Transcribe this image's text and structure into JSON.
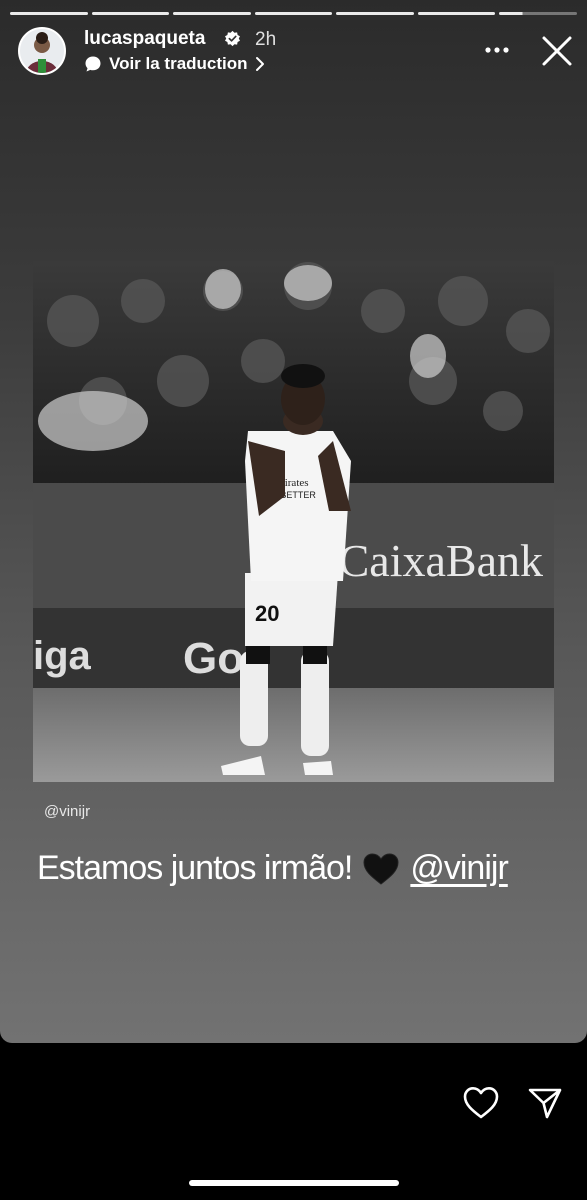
{
  "header": {
    "username": "lucaspaqueta",
    "time": "2h",
    "translate_label": "Voir la traduction",
    "progress_segments": 7,
    "active_segment_progress": 0.3
  },
  "media": {
    "photo_icon": "photo-image",
    "mention_sticker": "@vinijr",
    "photo_text": {
      "sponsor": "CaixaBank",
      "shirt_number": "20",
      "board_left": "iga",
      "board_mid": "Go",
      "shirt_brand": "Emirates",
      "shirt_sub": "FLY BETTER"
    }
  },
  "caption": {
    "text": "Estamos juntos irmão!",
    "tag": "@vinijr"
  },
  "colors": {
    "background": "#000000",
    "text": "#ffffff"
  }
}
